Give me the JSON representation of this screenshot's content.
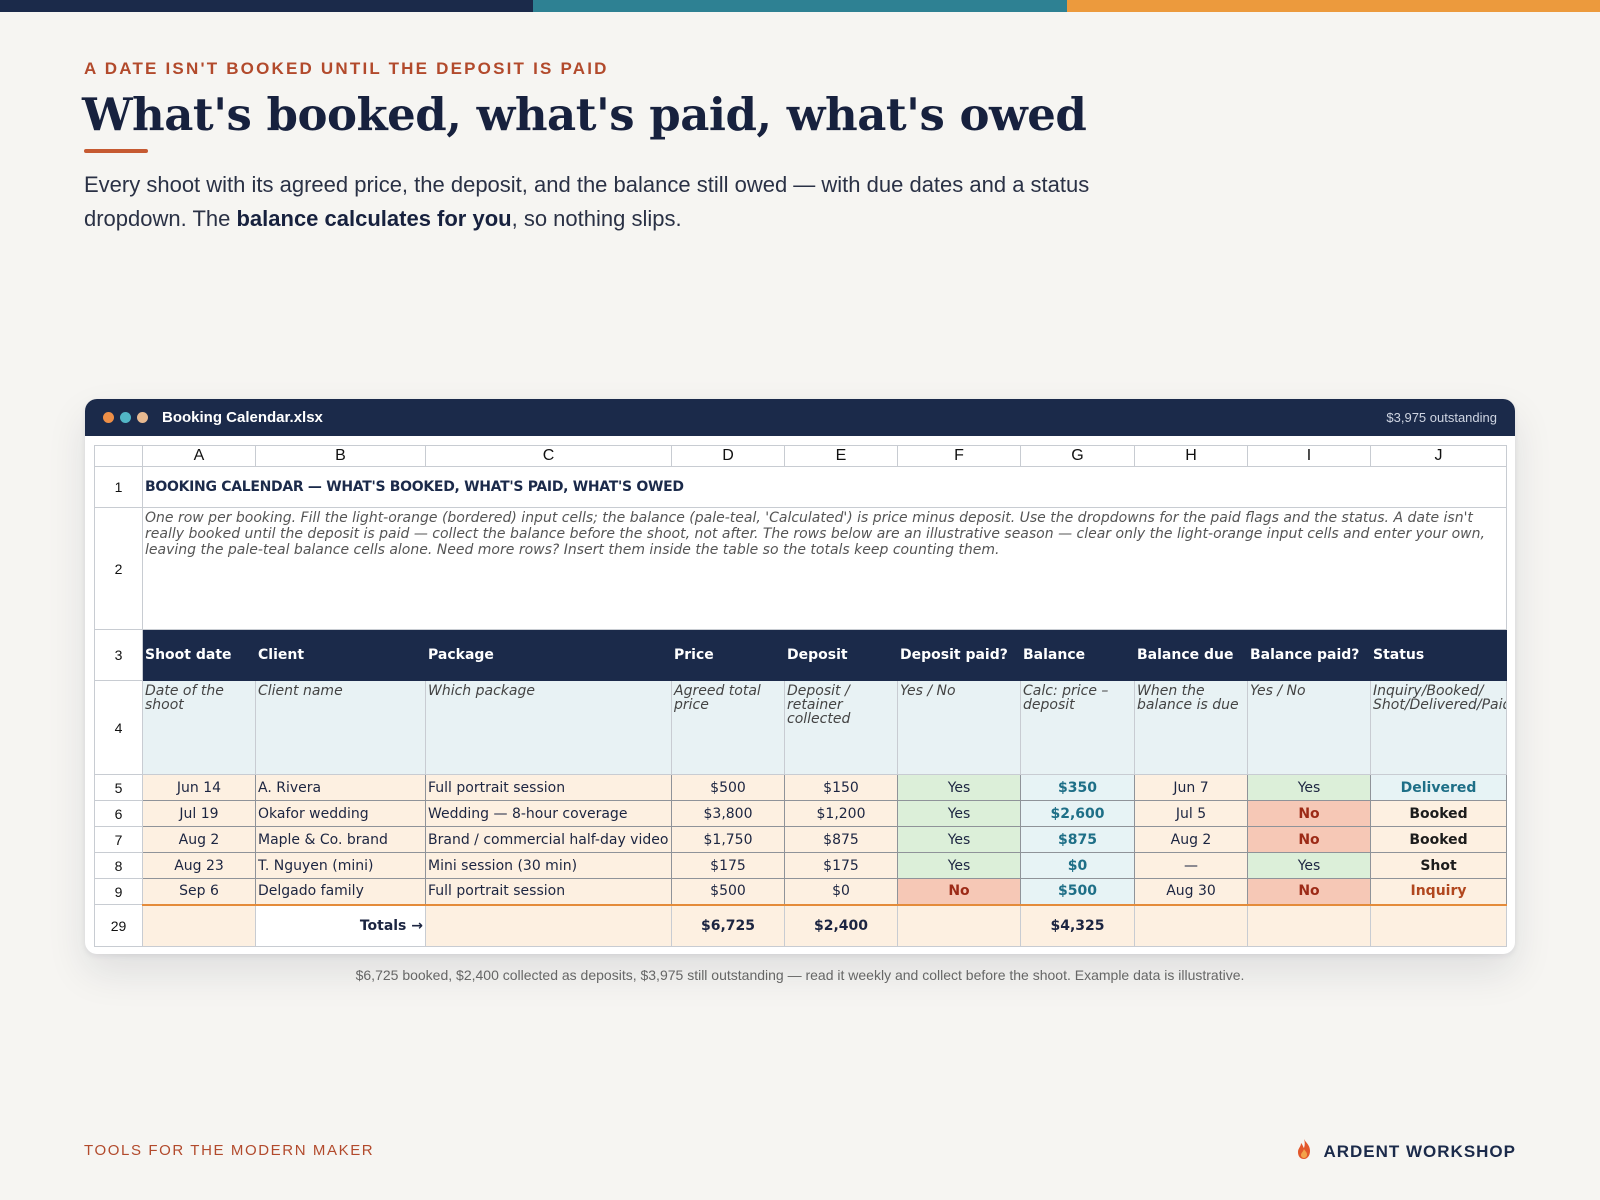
{
  "eyebrow": "A DATE ISN'T BOOKED UNTIL THE DEPOSIT IS PAID",
  "headline": "What's booked, what's paid, what's owed",
  "lede": {
    "part1": "Every shoot with its agreed price, the deposit, and the balance still owed — with due dates and a status dropdown. The ",
    "bold": "balance calculates for you",
    "part2": ", so nothing slips."
  },
  "window": {
    "filename": "Booking Calendar.xlsx",
    "outstanding": "$3,975 outstanding"
  },
  "sheet": {
    "columns": [
      "A",
      "B",
      "C",
      "D",
      "E",
      "F",
      "G",
      "H",
      "I",
      "J"
    ],
    "title": "BOOKING CALENDAR — WHAT'S BOOKED, WHAT'S PAID, WHAT'S OWED",
    "note": "One row per booking. Fill the light-orange (bordered) input cells; the balance (pale-teal, 'Calculated') is price minus deposit. Use the dropdowns for the paid flags and the status. A date isn't really booked until the deposit is paid — collect the balance before the shoot, not after. The rows below are an illustrative season — clear only the light-orange input cells and enter your own, leaving the pale-teal balance cells alone. Need more rows? Insert them inside the table so the totals keep counting them.",
    "headers": [
      "Shoot date",
      "Client",
      "Package",
      "Price",
      "Deposit",
      "Deposit paid?",
      "Balance",
      "Balance due",
      "Balance paid?",
      "Status"
    ],
    "subheaders": [
      "Date of the shoot",
      "Client name",
      "Which package",
      "Agreed total price",
      "Deposit / retainer collected",
      "Yes / No",
      "Calc: price – deposit",
      "When the balance is due",
      "Yes / No",
      "Inquiry/Booked/ Shot/Delivered/Paid"
    ],
    "rows": [
      {
        "n": "5",
        "date": "Jun 14",
        "client": "A. Rivera",
        "package": "Full portrait session",
        "price": "$500",
        "deposit": "$150",
        "dep_paid": "Yes",
        "balance": "$350",
        "due": "Jun 7",
        "bal_paid": "Yes",
        "status": "Delivered"
      },
      {
        "n": "6",
        "date": "Jul 19",
        "client": "Okafor wedding",
        "package": "Wedding — 8-hour coverage",
        "price": "$3,800",
        "deposit": "$1,200",
        "dep_paid": "Yes",
        "balance": "$2,600",
        "due": "Jul 5",
        "bal_paid": "No",
        "status": "Booked"
      },
      {
        "n": "7",
        "date": "Aug 2",
        "client": "Maple & Co. brand",
        "package": "Brand / commercial half-day video",
        "price": "$1,750",
        "deposit": "$875",
        "dep_paid": "Yes",
        "balance": "$875",
        "due": "Aug 2",
        "bal_paid": "No",
        "status": "Booked"
      },
      {
        "n": "8",
        "date": "Aug 23",
        "client": "T. Nguyen (mini)",
        "package": "Mini session (30 min)",
        "price": "$175",
        "deposit": "$175",
        "dep_paid": "Yes",
        "balance": "$0",
        "due": "—",
        "bal_paid": "Yes",
        "status": "Shot"
      },
      {
        "n": "9",
        "date": "Sep 6",
        "client": "Delgado family",
        "package": "Full portrait session",
        "price": "$500",
        "deposit": "$0",
        "dep_paid": "No",
        "balance": "$500",
        "due": "Aug 30",
        "bal_paid": "No",
        "status": "Inquiry"
      }
    ],
    "totals": {
      "n": "29",
      "label": "Totals →",
      "price": "$6,725",
      "deposit": "$2,400",
      "balance": "$4,325"
    },
    "row_numbers": {
      "r1": "1",
      "r2": "2",
      "r3": "3",
      "r4": "4"
    }
  },
  "caption": "$6,725 booked, $2,400 collected as deposits, $3,975 still outstanding — read it weekly and collect before the shoot. Example data is illustrative.",
  "footer": {
    "tagline": "TOOLS FOR THE MODERN MAKER",
    "brand": "ARDENT WORKSHOP",
    "logo_icon": "flame-icon"
  },
  "colors": {
    "navy": "#1b2a4a",
    "teal": "#2e8193",
    "orange": "#ec9a3d",
    "accent": "#b24a2c"
  }
}
